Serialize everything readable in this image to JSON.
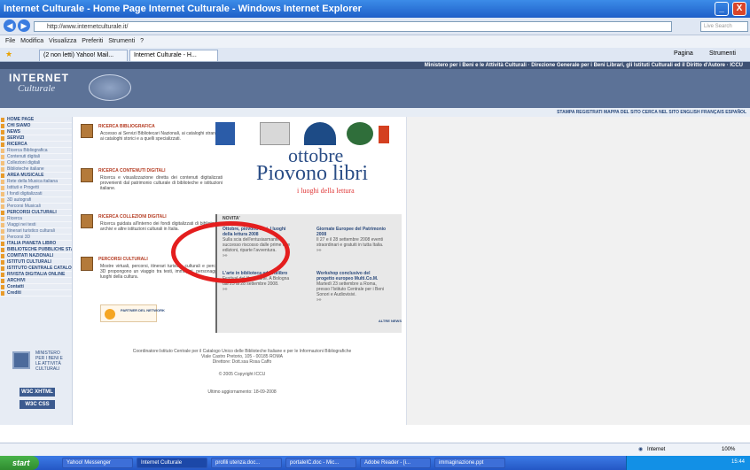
{
  "window": {
    "title": "Internet Culturale - Home Page Internet Culturale - Windows Internet Explorer",
    "min_label": "_",
    "close_label": "X"
  },
  "browser": {
    "url": "http://www.internetculturale.it/",
    "search_placeholder": "Live Search",
    "menu": [
      "File",
      "Modifica",
      "Visualizza",
      "Preferiti",
      "Strumenti",
      "?"
    ],
    "tabs": [
      "(2 non letti) Yahoo! Mail...",
      "Internet Culturale - H..."
    ],
    "toolbar_right": [
      "Pagina",
      "Strumenti"
    ]
  },
  "site": {
    "strip": "Ministero per i Beni e le Attività Culturali · Direzione Generale per i Beni Librari, gli Istituti Culturali ed il Diritto d'Autore · ICCU",
    "logo_line1": "INTERNET",
    "logo_line2": "Culturale",
    "topnav": "STAMPA  REGISTRATI  MAPPA DEL SITO  CERCA NEL SITO  ENGLISH  FRANÇAIS  ESPAÑOL"
  },
  "sidebar": {
    "items": [
      {
        "label": "HOME PAGE",
        "type": "hd"
      },
      {
        "label": "CHI SIAMO",
        "type": "hd"
      },
      {
        "label": "NEWS",
        "type": "hd"
      },
      {
        "label": "SERVIZI",
        "type": "hd"
      },
      {
        "label": "RICERCA",
        "type": "hd"
      },
      {
        "label": "Ricerca Bibliografica",
        "type": "sub"
      },
      {
        "label": "Contenuti digitali",
        "type": "sub"
      },
      {
        "label": "Collezioni digitali",
        "type": "sub"
      },
      {
        "label": "Biblioteche italiane",
        "type": "sub"
      },
      {
        "label": "AREA MUSICALE",
        "type": "hd"
      },
      {
        "label": "Rete della Musica italiana",
        "type": "sub"
      },
      {
        "label": "Istituti e Progetti",
        "type": "sub"
      },
      {
        "label": "I fondi digitalizzati",
        "type": "sub"
      },
      {
        "label": "3D autografi",
        "type": "sub"
      },
      {
        "label": "Percorsi Musicali",
        "type": "sub"
      },
      {
        "label": "PERCORSI CULTURALI",
        "type": "hd"
      },
      {
        "label": "Ricerca",
        "type": "sub"
      },
      {
        "label": "Viaggi nei testi",
        "type": "sub"
      },
      {
        "label": "Itinerari turistico culturali",
        "type": "sub"
      },
      {
        "label": "Percorsi 3D",
        "type": "sub"
      },
      {
        "label": "ITALIA PIANETA LIBRO",
        "type": "hd"
      },
      {
        "label": "BIBLIOTECHE PUBBLICHE STATALI",
        "type": "hd"
      },
      {
        "label": "COMITATI NAZIONALI",
        "type": "hd"
      },
      {
        "label": "ISTITUTI CULTURALI",
        "type": "hd"
      },
      {
        "label": "ISTITUTO CENTRALE CATALOGO UNICO",
        "type": "hd"
      },
      {
        "label": "RIVISTA DIGITALIA ONLINE",
        "type": "hd"
      },
      {
        "label": "ARCHIVI",
        "type": "hd"
      },
      {
        "label": "Contatti",
        "type": "hd"
      },
      {
        "label": "Crediti",
        "type": "hd"
      }
    ],
    "ministero": "MINISTERO PER I BENI E LE ATTIVITÀ CULTURALI",
    "w3c_1": "W3C XHTML",
    "w3c_2": "W3C CSS"
  },
  "services": [
    {
      "title": "RICERCA BIBLIOGRAFICA",
      "desc": "Accesso ai Servizi Bibliotecari Nazionali, ai cataloghi stranieri, ai cataloghi storici e a quelli specializzati."
    },
    {
      "title": "RICERCA CONTENUTI DIGITALI",
      "desc": "Ricerca e visualizzazione diretta dei contenuti digitalizzati provenienti dal patrimonio culturale di biblioteche e istituzioni italiane."
    },
    {
      "title": "RICERCA COLLEZIONI DIGITALI",
      "desc": "Ricerca guidata all'interno dei fondi digitalizzati di biblioteche, archivi e altre istituzioni culturali in Italia."
    },
    {
      "title": "PERCORSI CULTURALI",
      "desc": "Mostre virtuali, percorsi, itinerari turistico culturali e percorsi 3D propongono un viaggio tra testi, immagini, personaggi e luoghi della cultura."
    }
  ],
  "partner": "PARTNER DEL NETWORK",
  "ottobre": {
    "line1": "ottobre",
    "line2": "Piovono libri",
    "line3": "i luoghi della lettura"
  },
  "novita": {
    "heading": "NOVITA'",
    "items": [
      {
        "title": "Ottobre, piovono libri. I luoghi della lettura 2008",
        "desc": "Sulla scia dell'entusiasmante successo riscosso dalle prime due edizioni, riparte l'avventura.",
        "more": "»»"
      },
      {
        "title": "Giornate Europee del Patrimonio 2008",
        "desc": "Il 27 e il 28 settembre 2008 eventi straordinari e gratuiti in tutta Italia.",
        "more": "»»"
      },
      {
        "title": "L'arte in biblioteca ad Artelibro",
        "desc": "Festival del libro d'arte. A Bologna dal 25 al 28 settembre 2008.",
        "more": "»»"
      },
      {
        "title": "Workshop conclusivo del progetto europeo Multi.Co.M.",
        "desc": "Martedì 23 settembre a Roma, presso l'Istituto Centrale per i Beni Sonori e Audiovisivi.",
        "more": "»»"
      }
    ],
    "altre": "ALTRE NEWS"
  },
  "footer": {
    "line1": "Coordinatore:Istituto Centrale per il Catalogo Unico delle Biblioteche Italiane e per le Informazioni Bibliografiche",
    "line2": "Viale Castro Pretorio, 105 - 00185 ROMA",
    "line3": "Direttore: Dott.ssa Rosa Caffo",
    "copyright": "© 2005 Copyright ICCU",
    "updated": "Ultimo aggiornamento: 18-09-2008"
  },
  "status": {
    "zone": "Internet",
    "zoom": "100%"
  },
  "taskbar": {
    "start": "start",
    "tasks": [
      "Yahoo! Messenger",
      "Internet Culturale",
      "profili utenza.doc...",
      "portaleIC.doc - Mic...",
      "Adobe Reader - [i...",
      "immaginazione.ppt"
    ],
    "clock": "15:44"
  },
  "colors": {
    "accent": "#e41e1e",
    "header": "#5c7297",
    "sidebar_bullet": "#e89b2b"
  }
}
